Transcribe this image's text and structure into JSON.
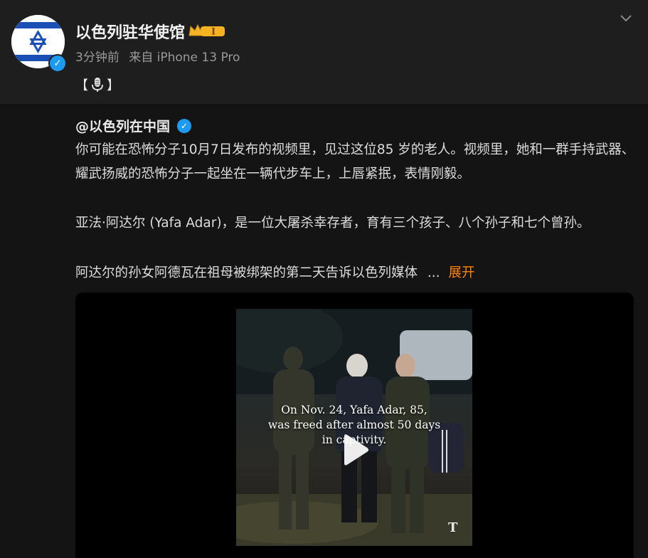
{
  "post": {
    "account_name": "以色列驻华使馆",
    "vip_level": "I",
    "time_ago": "3分钟前",
    "source": "来自 iPhone 13 Pro",
    "tag_open": "【",
    "tag_close": "】"
  },
  "repost": {
    "mention": "@以色列在中国",
    "paragraph1": "你可能在恐怖分子10月7日发布的视频里，见过这位85 岁的老人。视频里，她和一群手持武器、耀武扬威的恐怖分子一起坐在一辆代步车上，上唇紧抿，表情刚毅。",
    "paragraph2": "亚法·阿达尔 (Yafa Adar)，是一位大屠杀幸存者，育有三个孩子、八个孙子和七个曾孙。",
    "paragraph3": "阿达尔的孙女阿德瓦在祖母被绑架的第二天告诉以色列媒体",
    "ellipsis": "...",
    "expand_label": "展开"
  },
  "video": {
    "caption_line1": "On Nov. 24, Yafa Adar, 85,",
    "caption_line2": "was freed after almost 50 days",
    "caption_line3": "in captivity.",
    "logo_text": "T"
  },
  "colors": {
    "accent": "#ff8200",
    "verify_blue": "#1d9bf0",
    "vip_gold": "#f5b324"
  },
  "icons": {
    "avatar": "israel-flag-icon",
    "verified": "verified-check-icon",
    "vip": "crown-vip-icon",
    "menu": "chevron-down-icon",
    "mic": "microphone-icon",
    "play": "play-icon",
    "logo": "nyt-logo-icon"
  }
}
